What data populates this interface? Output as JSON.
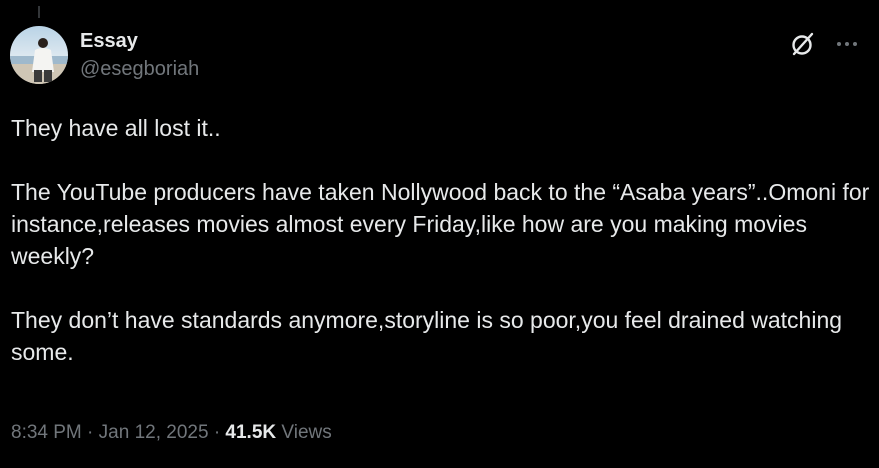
{
  "author": {
    "display_name": "Essay",
    "handle": "@esegboriah"
  },
  "tweet": {
    "paragraphs": [
      "They have all lost it..",
      "The YouTube producers have taken Nollywood back to the “Asaba years”..Omoni for instance,releases movies almost every Friday,like how are you making movies weekly?",
      "They don’t have standards anymore,storyline is so poor,you feel drained watching some."
    ]
  },
  "meta": {
    "time": "8:34 PM",
    "separator": "·",
    "date": "Jan 12, 2025",
    "views_count": "41.5K",
    "views_label": "Views"
  },
  "icons": {
    "grok": "grok-icon",
    "more": "more-horizontal-icon"
  },
  "colors": {
    "background": "#000000",
    "primary_text": "#e7e9ea",
    "secondary_text": "#71767b"
  }
}
